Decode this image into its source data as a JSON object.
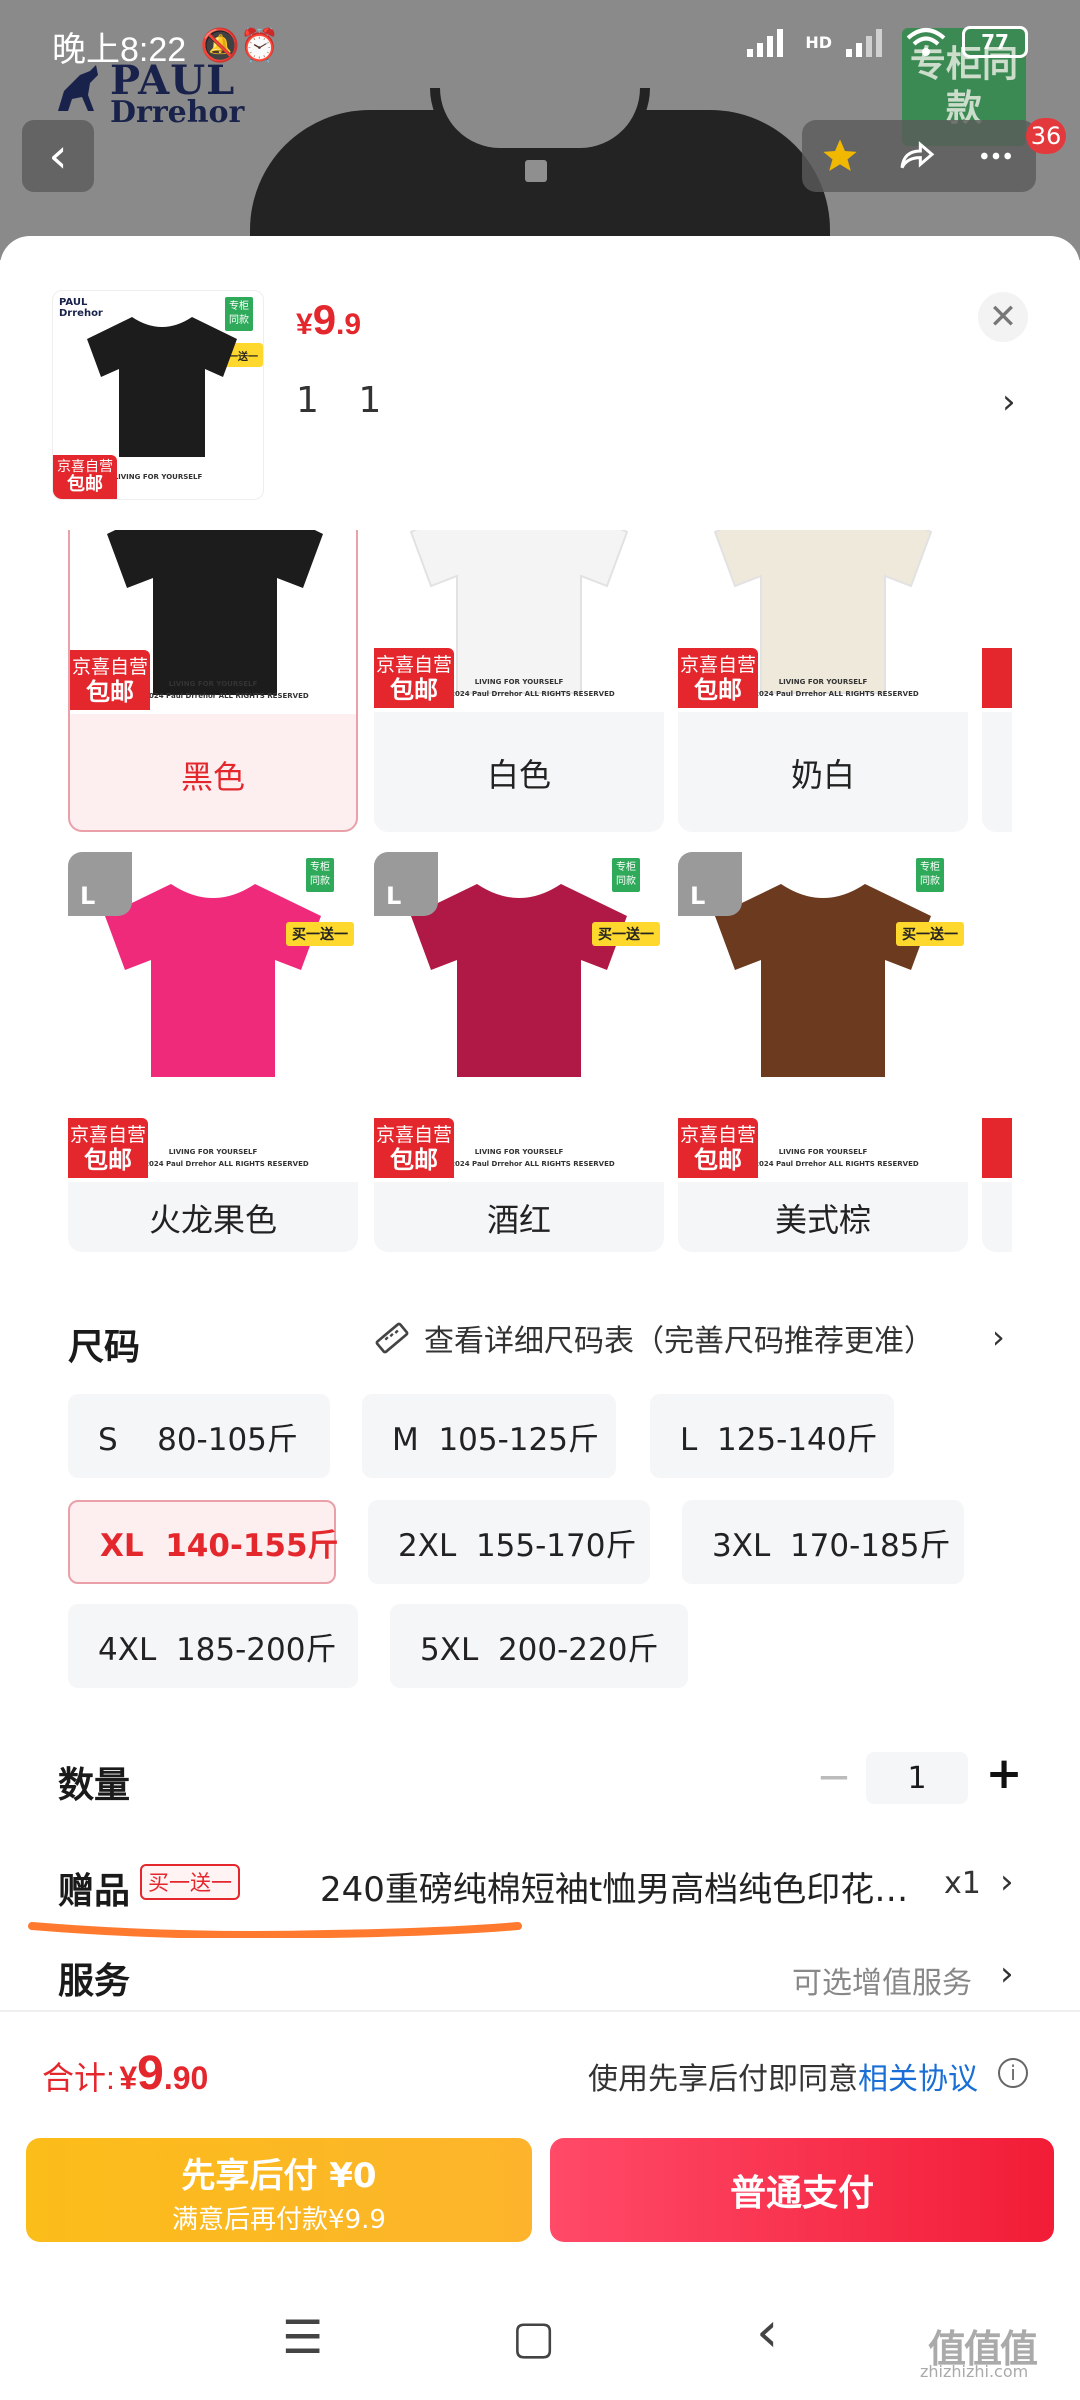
{
  "status_bar": {
    "time": "晚上8:22",
    "icons": "🔕⏰",
    "network": "HD",
    "battery": "77"
  },
  "background": {
    "brand_name": "PAUL",
    "brand_sub": "Drrehor",
    "same_style_badge": "专柜同款",
    "back_icon": "‹",
    "cart_badge": "36"
  },
  "product": {
    "price_symbol": "¥",
    "price_int": "9",
    "price_dec": ".9",
    "selected_spec": "1 1",
    "thumb": {
      "brand": "PAUL Drrehor",
      "same": "专柜同款",
      "buy_one": "买一送一",
      "jd_line1": "京喜自营",
      "jd_line2": "包邮",
      "caption": "LIVING FOR YOURSELF"
    }
  },
  "colors": [
    {
      "label": "黑色",
      "shirt": "#1c1c1c",
      "selected": true
    },
    {
      "label": "白色",
      "shirt": "#f4f4f4",
      "selected": false
    },
    {
      "label": "奶白",
      "shirt": "#efe9dc",
      "selected": false
    },
    {
      "label": "火龙果色",
      "shirt": "#ef2a7a",
      "selected": false
    },
    {
      "label": "酒红",
      "shirt": "#b01845",
      "selected": false
    },
    {
      "label": "美式棕",
      "shirt": "#6b3a1f",
      "selected": false
    }
  ],
  "card_text": {
    "jd_line1": "京喜自营",
    "jd_line2": "包邮",
    "buy_one": "买一送一",
    "same_style": "专柜同款",
    "size_badge": "L",
    "caption": "LIVING FOR YOURSELF",
    "copyright": "RIGHT 2024 Paul Drrehor ALL RIGHTS RESERVED"
  },
  "size": {
    "title": "尺码",
    "chart_link": "查看详细尺码表（完善尺码推荐更准）",
    "options": [
      {
        "label": "S    80-105斤",
        "selected": false
      },
      {
        "label": "M  105-125斤",
        "selected": false
      },
      {
        "label": "L  125-140斤",
        "selected": false
      },
      {
        "label": "XL  140-155斤",
        "selected": true
      },
      {
        "label": "2XL  155-170斤",
        "selected": false
      },
      {
        "label": "3XL  170-185斤",
        "selected": false
      },
      {
        "label": "4XL  185-200斤",
        "selected": false
      },
      {
        "label": "5XL  200-220斤",
        "selected": false
      }
    ]
  },
  "quantity": {
    "title": "数量",
    "value": "1",
    "minus": "−",
    "plus": "+"
  },
  "gift": {
    "title": "赠品",
    "tag": "买一送一",
    "description": "240重磅纯棉短袖t恤男高档纯色印花…",
    "count": "x1"
  },
  "service": {
    "title": "服务",
    "value": "可选增值服务"
  },
  "footer": {
    "total_label": "合计:",
    "total_symbol": "¥",
    "total_int": "9",
    "total_dec": ".90",
    "agree_text": "使用先享后付即同意",
    "agree_link": "相关协议",
    "pay_later_line1": "先享后付 ¥0",
    "pay_later_line2": "满意后再付款¥9.9",
    "pay_normal": "普通支付"
  },
  "navbar": {
    "menu": "☰",
    "home": "▢",
    "back": "‹"
  },
  "watermark": {
    "main": "值值值",
    "sub": "zhizhizhi.com"
  },
  "theme": {
    "accent_red": "#e4272d",
    "pay_orange": "#fbbd1a",
    "link_blue": "#1a6fd6"
  }
}
